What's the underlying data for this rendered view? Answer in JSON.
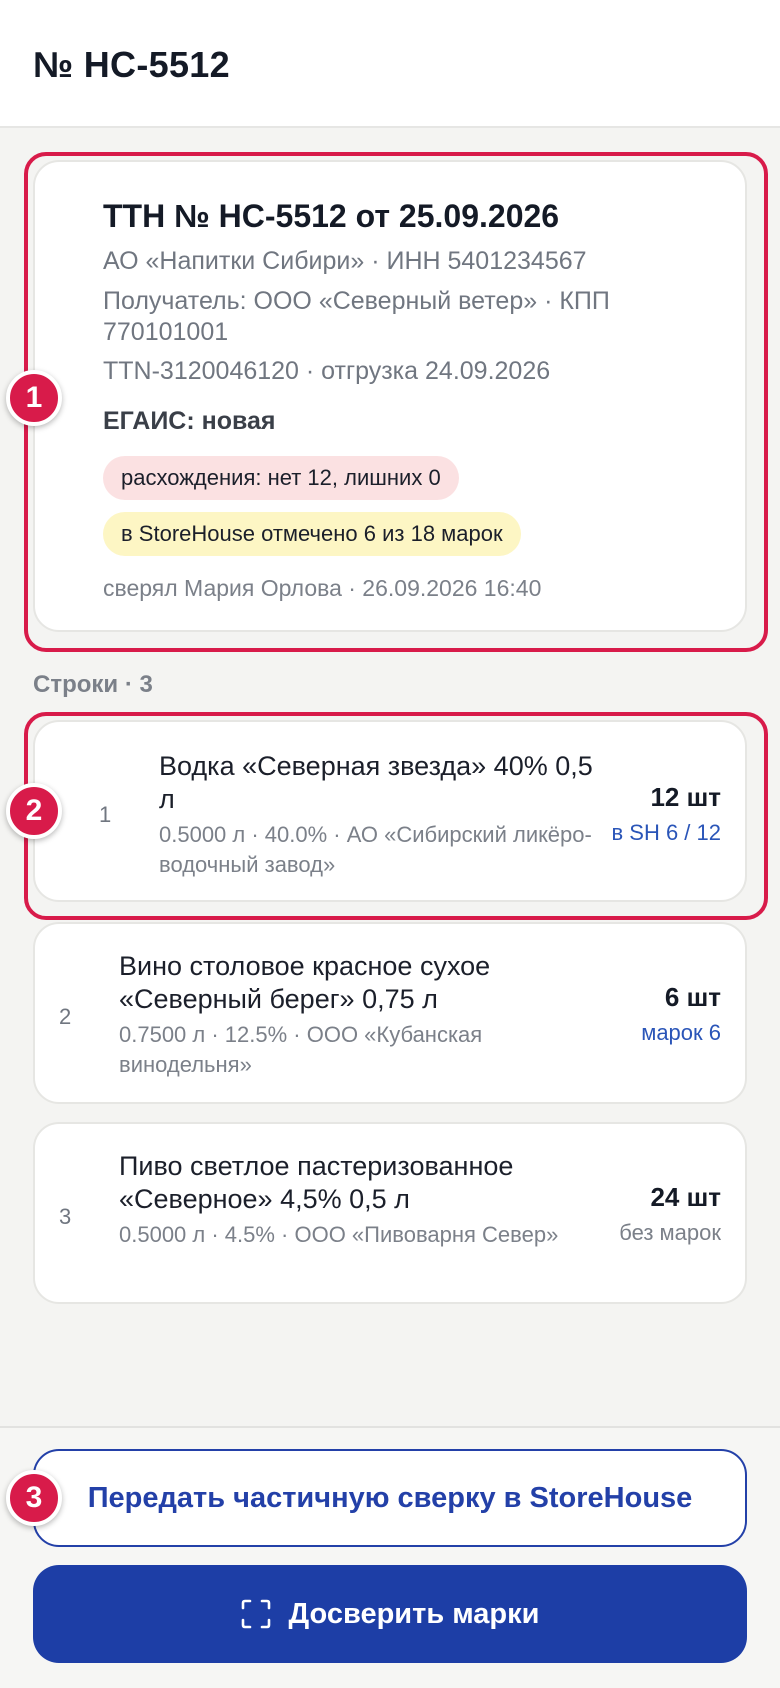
{
  "header": {
    "title": "№ НС-5512"
  },
  "summary": {
    "title": "ТТН № НС-5512 от 25.09.2026",
    "supplier": "АО «Напитки Сибири» · ИНН 5401234567",
    "recipient": "Получатель: ООО «Северный ветер» · КПП 770101001",
    "ttn": "TTN-3120046120 · отгрузка 24.09.2026",
    "egais": "ЕГАИС: новая",
    "discrepancy_chip": "расхождения: нет 12, лишних 0",
    "storehouse_chip": "в StoreHouse отмечено 6 из 18 марок",
    "checked_by": "сверял Мария Орлова · 26.09.2026 16:40"
  },
  "section": {
    "label": "Строки · 3"
  },
  "rows": [
    {
      "num": "1",
      "name": "Водка «Северная звезда» 40% 0,5 л",
      "meta": "0.5000 л · 40.0% · АО «Сибирский ликёро-водочный завод»",
      "qty": "12 шт",
      "sub": "в SH 6 / 12"
    },
    {
      "num": "2",
      "name": "Вино столовое красное сухое «Северный берег» 0,75 л",
      "meta": "0.7500 л · 12.5% · ООО «Кубанская винодельня»",
      "qty": "6 шт",
      "sub": "марок 6"
    },
    {
      "num": "3",
      "name": "Пиво светлое пастеризованное «Северное» 4,5% 0,5 л",
      "meta": "0.5000 л · 4.5% · ООО «Пивоварня Север»",
      "qty": "24 шт",
      "sub": "без марок"
    }
  ],
  "annotations": [
    "1",
    "2",
    "3"
  ],
  "buttons": {
    "transfer": "Передать частичную сверку в StoreHouse",
    "recheck": "Досверить марки",
    "recheck_icon": "scan-icon"
  },
  "colors": {
    "accent": "#1d3ea6",
    "highlight": "#d81b4a",
    "chip_red": "#fbe1e2",
    "chip_yellow": "#fdf6c4",
    "link_blue": "#2a55b8"
  }
}
